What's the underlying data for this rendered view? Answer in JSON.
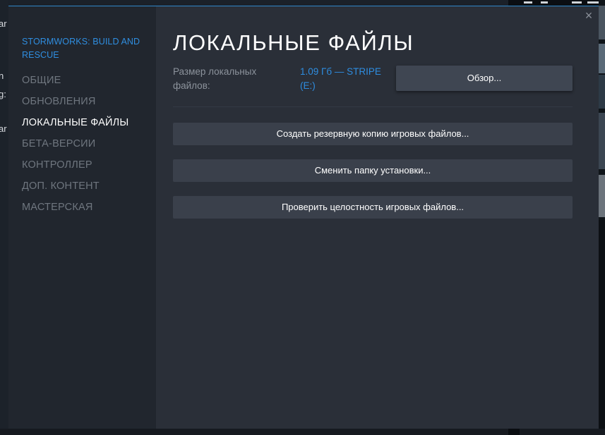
{
  "background": {
    "left_fragments": [
      "ar",
      "n",
      "g:",
      "ar"
    ]
  },
  "dialog": {
    "close_icon": "×",
    "sidebar": {
      "game_title": "STORMWORKS: BUILD AND RESCUE",
      "items": [
        {
          "label": "ОБЩИЕ",
          "active": false
        },
        {
          "label": "ОБНОВЛЕНИЯ",
          "active": false
        },
        {
          "label": "ЛОКАЛЬНЫЕ ФАЙЛЫ",
          "active": true
        },
        {
          "label": "БЕТА-ВЕРСИИ",
          "active": false
        },
        {
          "label": "КОНТРОЛЛЕР",
          "active": false
        },
        {
          "label": "ДОП. КОНТЕНТ",
          "active": false
        },
        {
          "label": "МАСТЕРСКАЯ",
          "active": false
        }
      ]
    },
    "main": {
      "title": "ЛОКАЛЬНЫЕ ФАЙЛЫ",
      "size_label": "Размер локальных файлов:",
      "size_value": "1.09 Гб — STRIPE (E:)",
      "browse_button": "Обзор...",
      "backup_button": "Создать резервную копию игровых файлов...",
      "move_button": "Сменить папку установки...",
      "verify_button": "Проверить целостность игровых файлов..."
    }
  },
  "colors": {
    "accent": "#2f8ee0",
    "sidebar_bg": "#21262e",
    "content_bg": "#2a2f38",
    "button_bg": "#3a404b",
    "nav_inactive": "#6f767f",
    "nav_active": "#ffffff"
  }
}
